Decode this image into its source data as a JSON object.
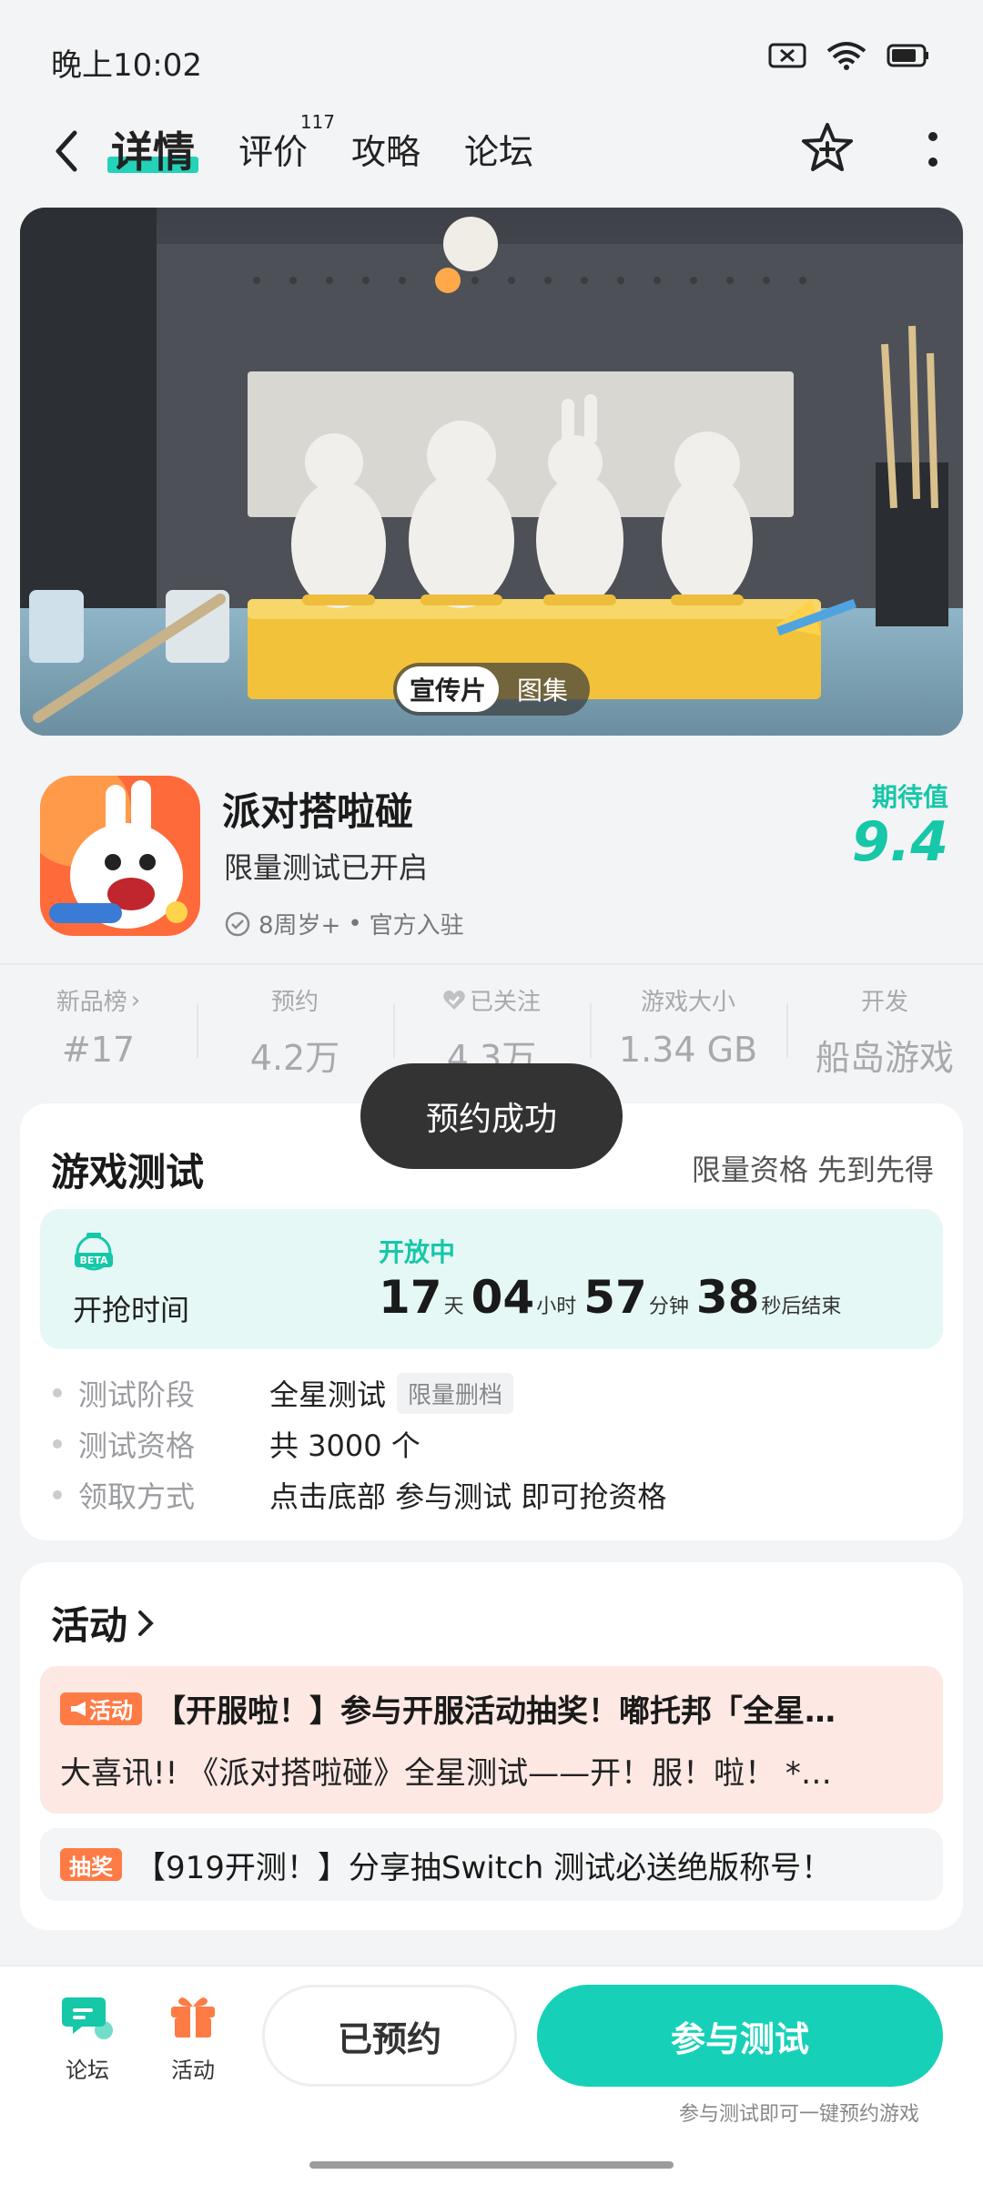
{
  "status_bar": {
    "time": "晚上10:02"
  },
  "nav": {
    "tabs": [
      {
        "label": "详情",
        "active": true
      },
      {
        "label": "评价",
        "badge": "117"
      },
      {
        "label": "攻略"
      },
      {
        "label": "论坛"
      }
    ]
  },
  "hero": {
    "segments": [
      "宣传片",
      "图集"
    ],
    "selected": "宣传片"
  },
  "game": {
    "name": "派对搭啦碰",
    "subtitle": "限量测试已开启",
    "age": "8周岁+",
    "official": "官方入驻",
    "expect_label": "期待值",
    "expect_value": "9.4"
  },
  "stats": [
    {
      "label": "新品榜",
      "value": "#17"
    },
    {
      "label": "预约",
      "value": "4.2万"
    },
    {
      "label": "已关注",
      "value": "4.3万"
    },
    {
      "label": "游戏大小",
      "value": "1.34 GB"
    },
    {
      "label": "开发",
      "value": "船岛游戏"
    }
  ],
  "toast": "预约成功",
  "test": {
    "title": "游戏测试",
    "right": "限量资格 先到先得",
    "timer_label": "开抢时间",
    "timer_status": "开放中",
    "days": "17",
    "days_unit": "天",
    "hours": "04",
    "hours_unit": "小时",
    "minutes": "57",
    "minutes_unit": "分钟",
    "seconds": "38",
    "seconds_unit": "秒后结束",
    "rows": [
      {
        "key": "测试阶段",
        "value": "全星测试",
        "tag": "限量删档"
      },
      {
        "key": "测试资格",
        "value": "共 3000 个"
      },
      {
        "key": "领取方式",
        "value": "点击底部 参与测试 即可抢资格"
      }
    ]
  },
  "activity": {
    "title": "活动",
    "items": [
      {
        "badge": "活动",
        "title": "【开服啦！】参与开服活动抽奖！嘟托邦「全星…",
        "desc": "大喜讯!! 《派对搭啦碰》全星测试——开！服！啦！ *…"
      },
      {
        "badge": "抽奖",
        "title": "【919开测！】分享抽Switch 测试必送绝版称号！"
      }
    ]
  },
  "bottom": {
    "forum": "论坛",
    "activity": "活动",
    "reserved": "已预约",
    "join": "参与测试",
    "hint": "参与测试即可一键预约游戏"
  },
  "colors": {
    "accent": "#16d1b7",
    "badge": "#ff7b46",
    "timer_bg": "#e5f8f6"
  }
}
